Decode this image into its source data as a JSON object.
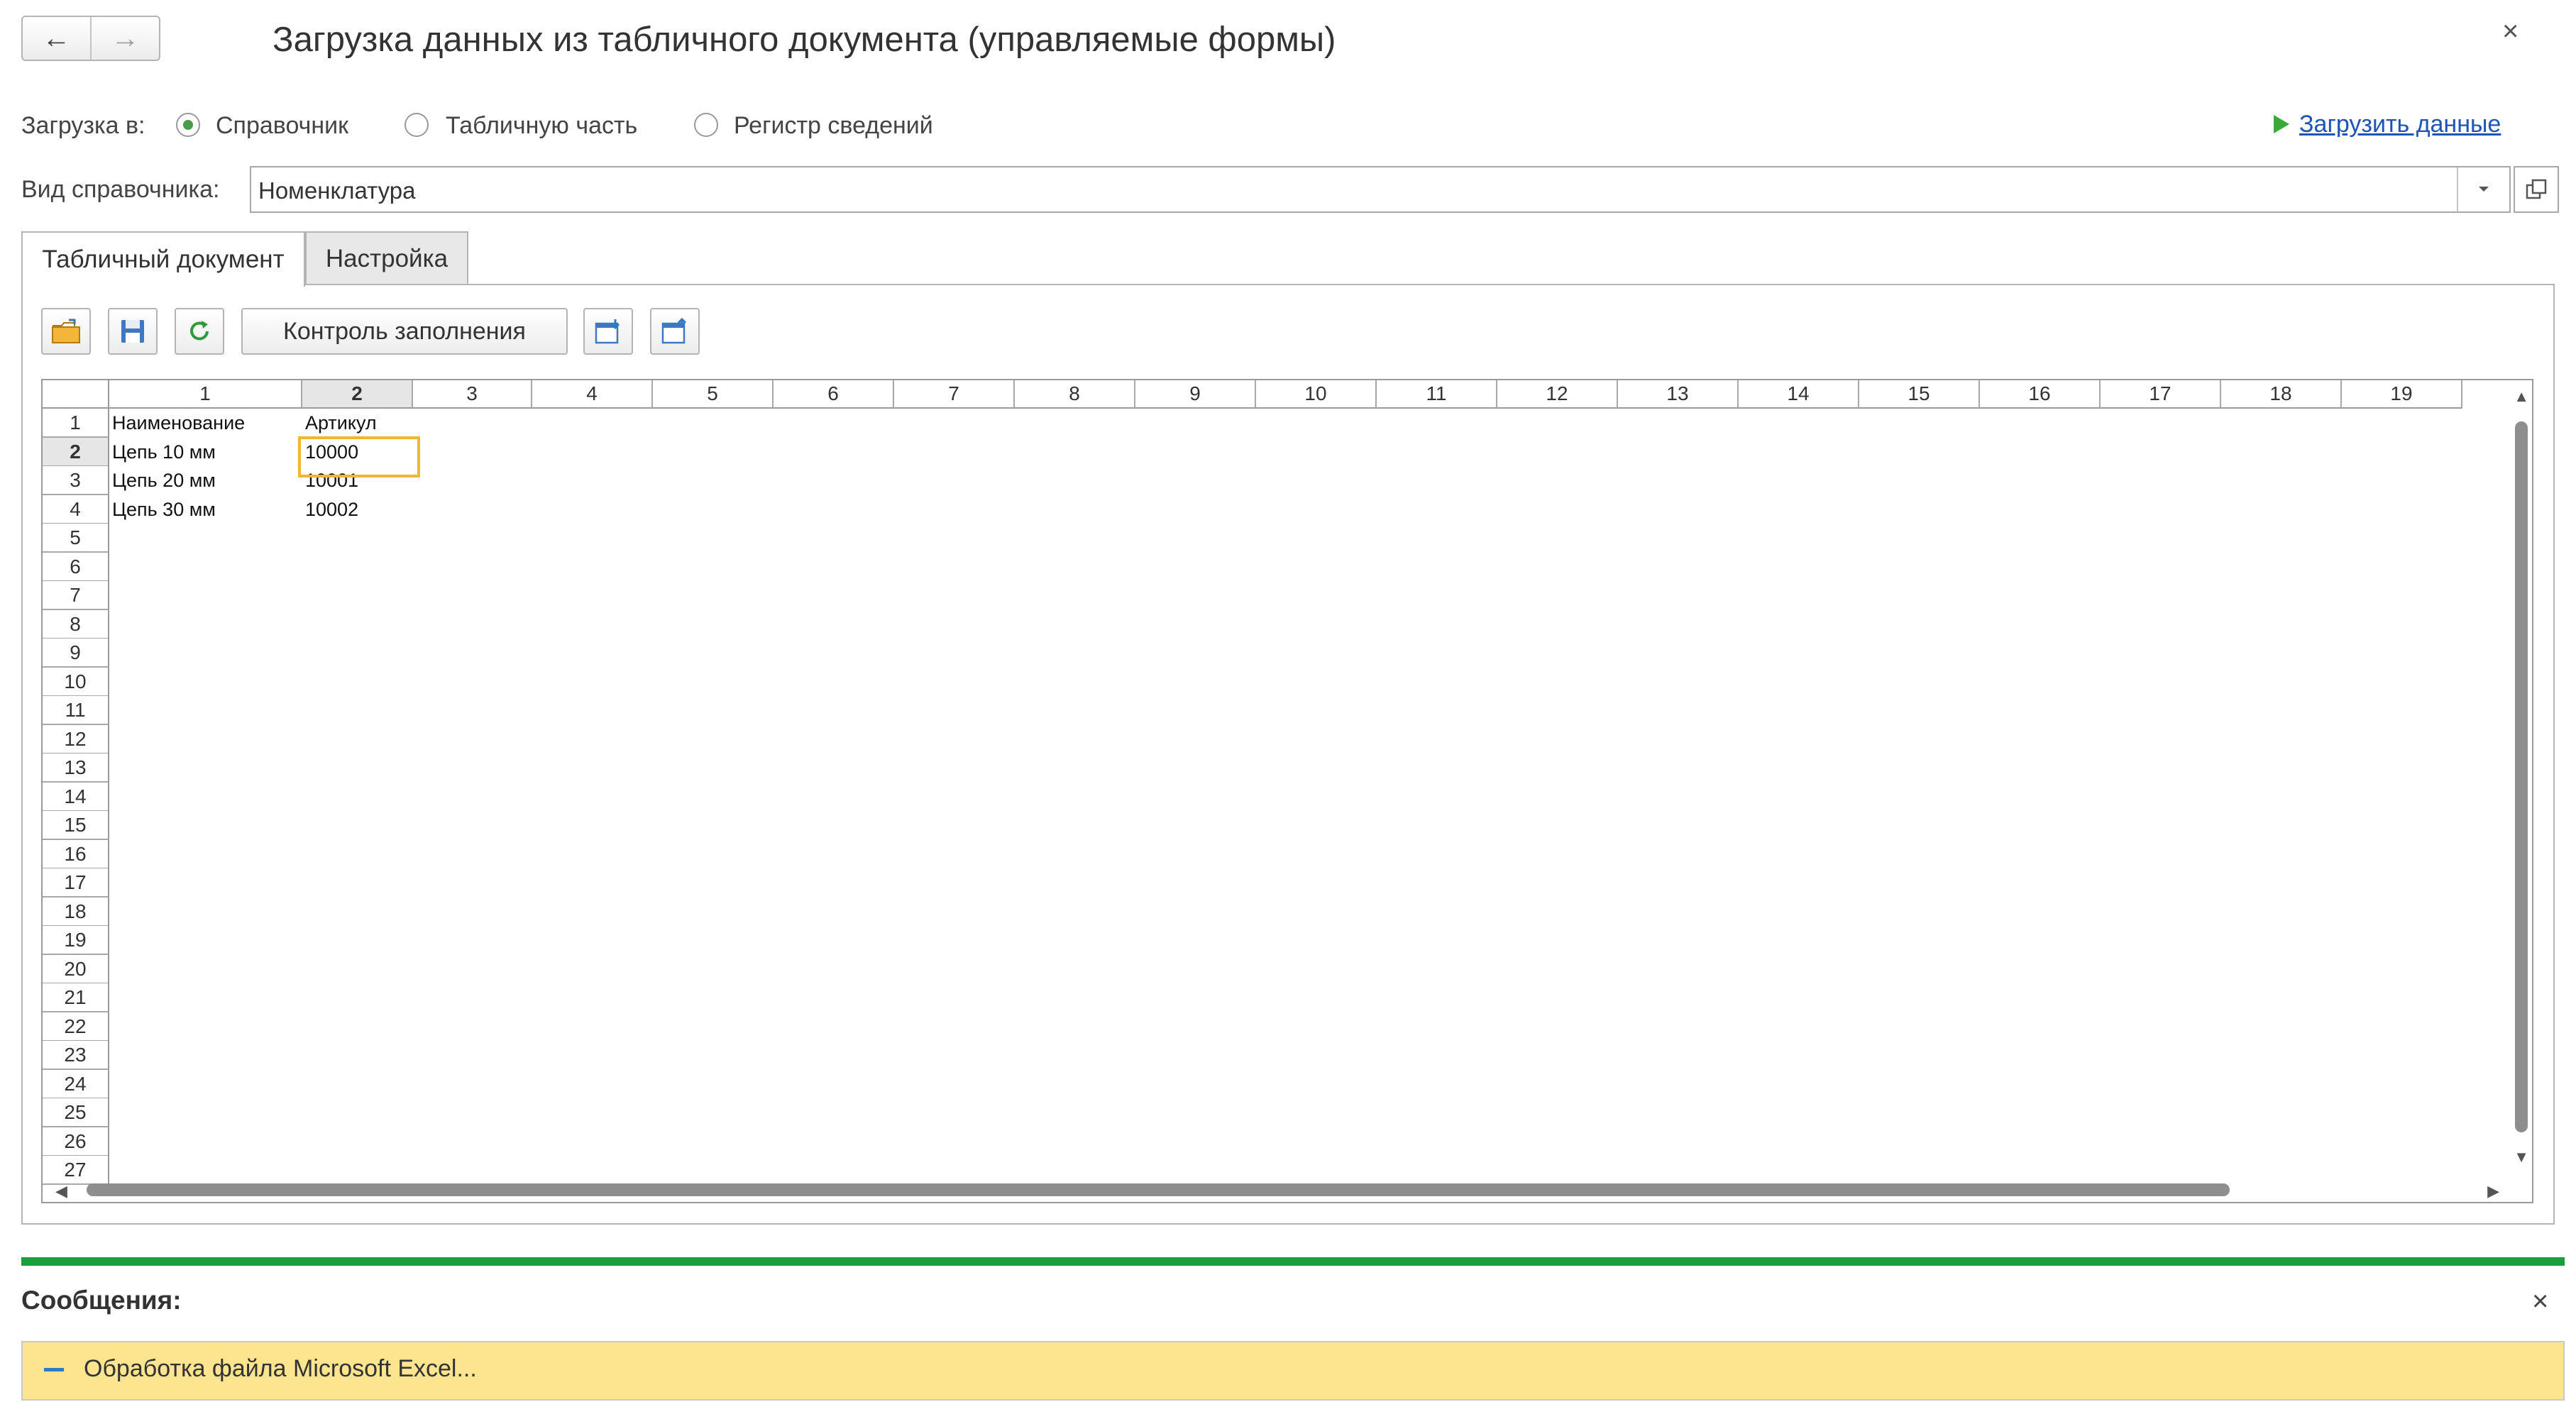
{
  "window": {
    "title": "Загрузка данных из табличного документа (управляемые формы)",
    "back_icon": "←",
    "forward_icon": "→",
    "close_icon": "×"
  },
  "load_target": {
    "label": "Загрузка в:",
    "options": [
      {
        "label": "Справочник",
        "selected": true
      },
      {
        "label": "Табличную часть",
        "selected": false
      },
      {
        "label": "Регистр сведений",
        "selected": false
      }
    ]
  },
  "load_data_link": "Загрузить данные",
  "catalog_type": {
    "label": "Вид справочника:",
    "value": "Номенклатура"
  },
  "tabs": [
    {
      "label": "Табличный документ",
      "active": true
    },
    {
      "label": "Настройка",
      "active": false
    }
  ],
  "toolbar": {
    "fill_check_label": "Контроль заполнения",
    "icons": [
      "open-file-icon",
      "save-icon",
      "refresh-icon",
      "import-icon",
      "export-icon"
    ]
  },
  "spreadsheet": {
    "column_headers": [
      "1",
      "2",
      "3",
      "4",
      "5",
      "6",
      "7",
      "8",
      "9",
      "10",
      "11",
      "12",
      "13",
      "14",
      "15",
      "16",
      "17",
      "18",
      "19"
    ],
    "row_headers": [
      "1",
      "2",
      "3",
      "4",
      "5",
      "6",
      "7",
      "8",
      "9",
      "10",
      "11",
      "12",
      "13",
      "14",
      "15",
      "16",
      "17",
      "18",
      "19",
      "20",
      "21",
      "22",
      "23",
      "24",
      "25",
      "26",
      "27"
    ],
    "selected_row": "2",
    "selected_col": "2",
    "rows": [
      [
        "Наименование",
        "Артикул"
      ],
      [
        "Цепь 10 мм",
        "10000"
      ],
      [
        "Цепь 20 мм",
        "10001"
      ],
      [
        "Цепь 30 мм",
        "10002"
      ]
    ]
  },
  "messages": {
    "title": "Сообщения:",
    "close_icon": "×",
    "items": [
      "Обработка файла Microsoft Excel..."
    ]
  },
  "colors": {
    "accent_green": "#18a03c",
    "link_blue": "#1e53b8",
    "message_bg": "#fde58f",
    "selection_border": "#f0b82e"
  }
}
